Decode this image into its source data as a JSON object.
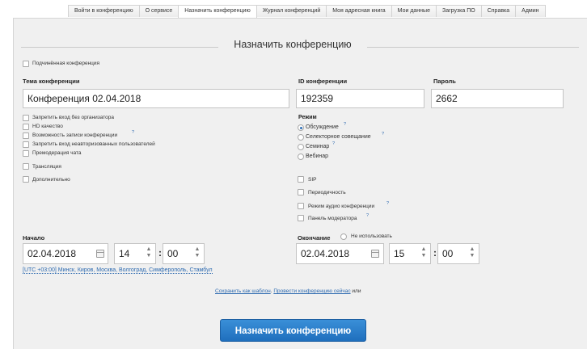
{
  "tabs": [
    {
      "label": "Войти в конференцию"
    },
    {
      "label": "О сервисе"
    },
    {
      "label": "Назначить конференцию"
    },
    {
      "label": "Журнал конференций"
    },
    {
      "label": "Моя адресная книга"
    },
    {
      "label": "Мои данные"
    },
    {
      "label": "Загрузка ПО"
    },
    {
      "label": "Справка"
    },
    {
      "label": "Админ"
    }
  ],
  "form": {
    "title": "Назначить конференцию",
    "subordinate_label": "Подчинённая конференция",
    "topic_label": "Тема конференции",
    "topic_value": "Конференция 02.04.2018",
    "id_label": "ID конференции",
    "id_value": "192359",
    "password_label": "Пароль",
    "password_value": "2662",
    "options": [
      "Запретить вход без организатора",
      "HD качество",
      "Возможность записи конференции",
      "Запретить вход неавторизованных пользователей",
      "Премодерация чата"
    ],
    "broadcast_label": "Трансляция",
    "extra_label": "Дополнительно",
    "mode_label": "Режим",
    "modes": [
      "Обсуждение",
      "Селекторное совещание",
      "Семинар",
      "Вебинар"
    ],
    "sip_label": "SIP",
    "periodic_label": "Периодичность",
    "audio_mode_label": "Режим аудио конференции",
    "moderator_panel_label": "Панель модератора",
    "help_mark": "?",
    "start_label": "Начало",
    "start_date": "02.04.2018",
    "start_hour": "14",
    "start_minute": "00",
    "end_label": "Окончание",
    "not_used_label": "Не использовать",
    "end_date": "02.04.2018",
    "end_hour": "15",
    "end_minute": "00",
    "colon": ":",
    "timezone": "[UTC +03:00] Минск, Киров, Москва, Волгоград, Симферополь, Стамбул",
    "save_template": "Сохранить как шаблон",
    "dot": ".",
    "run_now": "Провести конференцию сейчас",
    "or": "или",
    "submit_label": "Назначить конференцию"
  },
  "icons": {
    "spinner_up": "▲",
    "spinner_down": "▼"
  },
  "colors": {
    "accent": "#1f6fbd",
    "link": "#2d6ab0"
  }
}
